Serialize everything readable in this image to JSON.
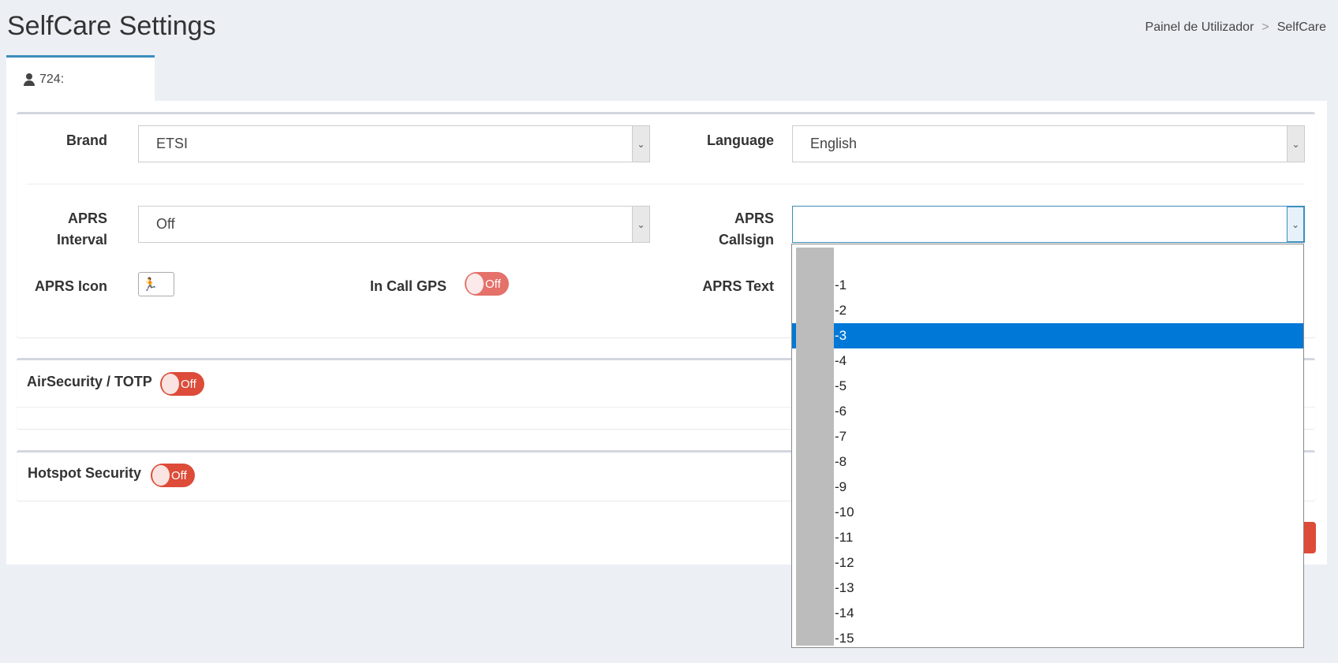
{
  "header": {
    "title": "SelfCare Settings",
    "breadcrumb": [
      "Painel de Utilizador",
      ">",
      "SelfCare"
    ]
  },
  "tab": {
    "label": "724:"
  },
  "form": {
    "brand_label": "Brand",
    "brand_value": "ETSI",
    "language_label": "Language",
    "language_value": "English",
    "aprs_interval_label_1": "APRS",
    "aprs_interval_label_2": "Interval",
    "aprs_interval_value": "Off",
    "aprs_callsign_label_1": "APRS",
    "aprs_callsign_label_2": "Callsign",
    "aprs_callsign_value": "",
    "aprs_icon_label": "APRS Icon",
    "in_call_gps_label": "In Call GPS",
    "in_call_gps_toggle": "Off",
    "aprs_text_label": "APRS Text"
  },
  "panels": {
    "airsecurity_title": "AirSecurity / TOTP",
    "airsecurity_toggle": "Off",
    "hotspot_title": "Hotspot Security",
    "hotspot_toggle": "Off"
  },
  "dropdown": {
    "selected_index": 3,
    "options": [
      "",
      "-1",
      "-2",
      "-3",
      "-4",
      "-5",
      "-6",
      "-7",
      "-8",
      "-9",
      "-10",
      "-11",
      "-12",
      "-13",
      "-14",
      "-15"
    ]
  },
  "colors": {
    "accent": "#3c8dbc",
    "danger": "#dd4b39",
    "selected_option": "#0078d7",
    "background": "#ecf0f5"
  },
  "icons": {
    "tab": "user-icon",
    "aprs_icon": "runner-icon",
    "select_arrow": "chevron-down-icon"
  }
}
